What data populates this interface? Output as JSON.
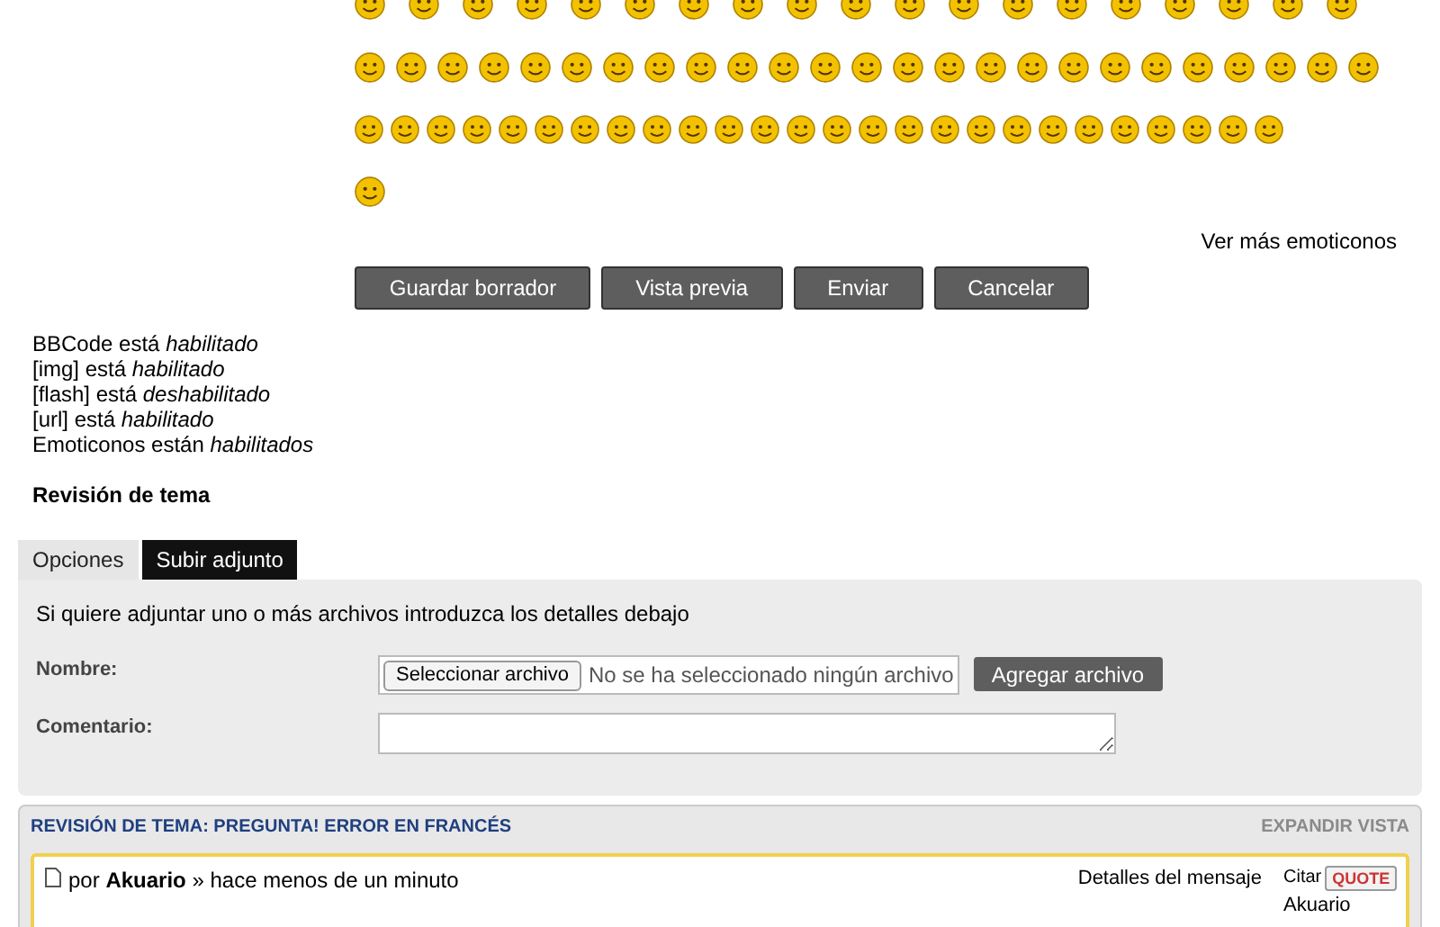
{
  "emoticons_link": "Ver más emoticonos",
  "buttons": [
    {
      "label": "Guardar borrador"
    },
    {
      "label": "Vista previa"
    },
    {
      "label": "Enviar"
    },
    {
      "label": "Cancelar"
    }
  ],
  "bbcode_status": [
    {
      "name": "BBCode está",
      "state": "habilitado"
    },
    {
      "name": "[img] está",
      "state": "habilitado"
    },
    {
      "name": "[flash] está",
      "state": "deshabilitado"
    },
    {
      "name": "[url] está",
      "state": "habilitado"
    },
    {
      "name": "Emoticonos están",
      "state": "habilitados"
    }
  ],
  "topic_review_heading": "Revisión de tema",
  "tabs": [
    {
      "label": "Opciones",
      "selected": false
    },
    {
      "label": "Subir adjunto",
      "selected": true
    }
  ],
  "attach_panel": {
    "intro": "Si quiere adjuntar uno o más archivos introduzca los detalles debajo",
    "name_label": "Nombre:",
    "file_button": "Seleccionar archivo",
    "file_status": "No se ha seleccionado ningún archivo",
    "add_button": "Agregar archivo",
    "comment_label": "Comentario:"
  },
  "review": {
    "title": "REVISIÓN DE TEMA: PREGUNTA! ERROR EN FRANCÉS",
    "expand": "EXPANDIR VISTA",
    "post": {
      "by": "por",
      "author": "Akuario",
      "time": "» hace menos de un minuto",
      "details": "Detalles del mensaje",
      "quote_label": "Citar",
      "quote_button": "QUOTE",
      "quote_author": "Akuario"
    }
  }
}
